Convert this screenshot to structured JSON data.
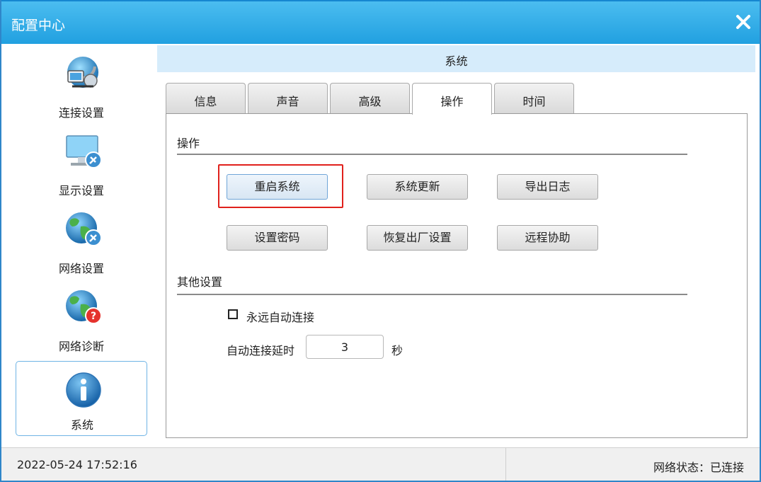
{
  "window": {
    "title": "配置中心",
    "accent": "#21a0e0"
  },
  "sidebar": {
    "items": [
      {
        "label": "连接设置",
        "icon": "connection-settings-icon",
        "active": false
      },
      {
        "label": "显示设置",
        "icon": "display-settings-icon",
        "active": false
      },
      {
        "label": "网络设置",
        "icon": "network-settings-icon",
        "active": false
      },
      {
        "label": "网络诊断",
        "icon": "network-diagnosis-icon",
        "active": false
      },
      {
        "label": "系统",
        "icon": "info-icon",
        "active": true
      }
    ]
  },
  "main": {
    "header": "系统",
    "tabs": [
      {
        "label": "信息",
        "active": false
      },
      {
        "label": "声音",
        "active": false
      },
      {
        "label": "高级",
        "active": false
      },
      {
        "label": "操作",
        "active": true
      },
      {
        "label": "时间",
        "active": false
      }
    ],
    "operations": {
      "title": "操作",
      "buttons": [
        "重启系统",
        "系统更新",
        "导出日志",
        "设置密码",
        "恢复出厂设置",
        "远程协助"
      ],
      "highlighted": "重启系统",
      "highlight_color": "#e0211c"
    },
    "other": {
      "title": "其他设置",
      "auto_connect_label": "永远自动连接",
      "auto_connect_checked": false,
      "delay_label": "自动连接延时",
      "delay_value": "3",
      "delay_unit": "秒"
    }
  },
  "status": {
    "datetime": "2022-05-24 17:52:16",
    "network": "网络状态：已连接"
  }
}
